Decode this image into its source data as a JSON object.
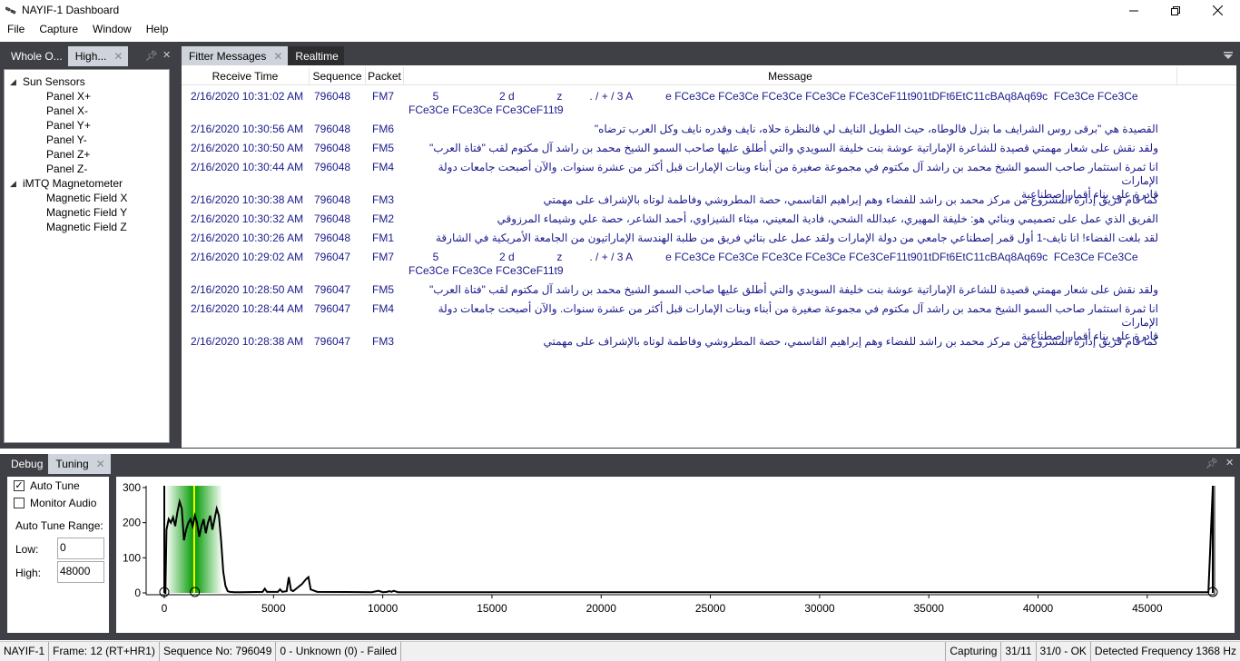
{
  "window": {
    "title": "NAYIF-1 Dashboard"
  },
  "menu": [
    "File",
    "Capture",
    "Window",
    "Help"
  ],
  "left_tabs": [
    {
      "label": "Whole O..."
    },
    {
      "label": "High..."
    }
  ],
  "main_tabs": [
    {
      "label": "Fitter Messages"
    },
    {
      "label": "Realtime"
    }
  ],
  "tree": {
    "groups": [
      {
        "label": "Sun Sensors",
        "children": [
          "Panel X+",
          "Panel X-",
          "Panel Y+",
          "Panel Y-",
          "Panel Z+",
          "Panel Z-"
        ]
      },
      {
        "label": "iMTQ Magnetometer",
        "children": [
          "Magnetic Field X",
          "Magnetic Field Y",
          "Magnetic Field Z"
        ]
      }
    ]
  },
  "grid": {
    "columns": [
      "Receive Time",
      "Sequence",
      "Packet",
      "Message"
    ],
    "rows": [
      {
        "time": "2/16/2020 10:31:02 AM",
        "seq": "796048",
        "packet": "FM7",
        "message": "        5                    2 d              z         . / + / 3 A           e FCe3Ce FCe3Ce FCe3Ce FCe3Ce FCe3CeF11t901tDFt6EtC11cBAq8Aq69c  FCe3Ce FCe3Ce\nFCe3Ce FCe3Ce FCe3CeF11t9",
        "ltr": true
      },
      {
        "time": "2/16/2020 10:30:56 AM",
        "seq": "796048",
        "packet": "FM6",
        "message": "القصيدة هي \"برقى روس الشرايف ما بنزل فالوطاه، حيث الطويل النايف لي فالنظرة حلاه، نايف وقدره نايف وكل العرب ترضاه\""
      },
      {
        "time": "2/16/2020 10:30:50 AM",
        "seq": "796048",
        "packet": "FM5",
        "message": "ولقد نقش على شعار مهمتي قصيدة للشاعرة الإماراتية عوشة بنت خليفة السويدي والتي أطلق عليها صاحب السمو الشيخ محمد بن راشد آل مكتوم لقب \"فتاة العرب\""
      },
      {
        "time": "2/16/2020 10:30:44 AM",
        "seq": "796048",
        "packet": "FM4",
        "message": "انا ثمرة استثمار صاحب السمو الشيخ محمد بن راشد آل مكتوم في مجموعة صغيرة من أبناء وبنات الإمارات قبل أكثر من عشرة سنوات. والآن أصبحت جامعات دولة الإمارات\nقادرة على بناء أقمار إصطناعية"
      },
      {
        "time": "2/16/2020 10:30:38 AM",
        "seq": "796048",
        "packet": "FM3",
        "message": "كما قام فريق إدارة المشروع من مركز محمد بن راشد للفضاء وهم إبراهيم القاسمي، حصة المطروشي وفاطمة لوتاه بالإشراف على مهمتي"
      },
      {
        "time": "2/16/2020 10:30:32 AM",
        "seq": "796048",
        "packet": "FM2",
        "message": "الفريق الذي عمل على تصميمي وبنائي هو: خليفة المهيري، عبدالله الشحي، فادية المعيني، ميثاء الشيزاوي، أحمد الشاعر، حصة علي وشيماء المرزوقي"
      },
      {
        "time": "2/16/2020 10:30:26 AM",
        "seq": "796048",
        "packet": "FM1",
        "message": "لقد بلغت الفضاء! انا نايف-1 أول قمر إصطناعي جامعي من دولة الإمارات ولقد عمل على بنائي فريق من طلبة الهندسة الإماراتيون من الجامعة الأمريكية في الشارقة"
      },
      {
        "time": "2/16/2020 10:29:02 AM",
        "seq": "796047",
        "packet": "FM7",
        "message": "        5                    2 d              z         . / + / 3 A           e FCe3Ce FCe3Ce FCe3Ce FCe3Ce FCe3CeF11t901tDFt6EtC11cBAq8Aq69c  FCe3Ce FCe3Ce\nFCe3Ce FCe3Ce FCe3CeF11t9",
        "ltr": true
      },
      {
        "time": "2/16/2020 10:28:50 AM",
        "seq": "796047",
        "packet": "FM5",
        "message": "ولقد نقش على شعار مهمتي قصيدة للشاعرة الإماراتية عوشة بنت خليفة السويدي والتي أطلق عليها صاحب السمو الشيخ محمد بن راشد آل مكتوم لقب \"فتاة العرب\""
      },
      {
        "time": "2/16/2020 10:28:44 AM",
        "seq": "796047",
        "packet": "FM4",
        "message": "انا ثمرة استثمار صاحب السمو الشيخ محمد بن راشد آل مكتوم في مجموعة صغيرة من أبناء وبنات الإمارات قبل أكثر من عشرة سنوات. والآن أصبحت جامعات دولة الإمارات\nقادرة على بناء أقمار إصطناعية"
      },
      {
        "time": "2/16/2020 10:28:38 AM",
        "seq": "796047",
        "packet": "FM3",
        "message": "كما قام فريق إدارة المشروع من مركز محمد بن راشد للفضاء وهم إبراهيم القاسمي، حصة المطروشي وفاطمة لوتاه بالإشراف على مهمتي"
      }
    ]
  },
  "bottom_tabs": [
    {
      "label": "Debug"
    },
    {
      "label": "Tuning"
    }
  ],
  "tuning": {
    "auto_tune_label": "Auto Tune",
    "auto_tune_checked": true,
    "monitor_audio_label": "Monitor Audio",
    "monitor_audio_checked": false,
    "range_label": "Auto Tune Range:",
    "low_label": "Low:",
    "low_value": "0",
    "high_label": "High:",
    "high_value": "48000"
  },
  "chart_data": {
    "type": "line",
    "x_ticks": [
      0,
      5000,
      10000,
      15000,
      20000,
      25000,
      30000,
      35000,
      40000,
      45000
    ],
    "y_ticks": [
      0,
      100,
      200,
      300
    ],
    "xlim": [
      0,
      48000
    ],
    "ylim": [
      0,
      300
    ],
    "markers": [
      0,
      1400,
      48000
    ],
    "tuned_frequency": 1368,
    "series": [
      {
        "x": [
          0,
          50,
          100,
          200,
          300,
          400,
          500,
          600,
          700,
          800,
          900,
          1000,
          1100,
          1200,
          1300,
          1400,
          1500,
          1600,
          1700,
          1800,
          1900,
          2000,
          2100,
          2200,
          2300,
          2400,
          2500,
          2600,
          2700,
          2800,
          2900,
          3000,
          3200,
          3500,
          4500,
          4600,
          4700,
          5200,
          5300,
          5400,
          5600,
          5700,
          5800,
          5900,
          6000,
          6300,
          6500,
          6600,
          6700,
          7000,
          9500,
          9800,
          10000,
          10200,
          10300,
          10400,
          10500,
          10700,
          15000,
          25000,
          35000,
          47800,
          48000
        ],
        "values": [
          0,
          0,
          180,
          210,
          200,
          215,
          190,
          230,
          260,
          240,
          150,
          180,
          200,
          210,
          190,
          220,
          200,
          160,
          190,
          210,
          170,
          200,
          220,
          180,
          210,
          240,
          220,
          150,
          60,
          20,
          5,
          3,
          2,
          2,
          3,
          12,
          3,
          3,
          10,
          3,
          5,
          45,
          8,
          5,
          10,
          25,
          40,
          45,
          10,
          3,
          2,
          6,
          2,
          3,
          5,
          3,
          6,
          2,
          2,
          2,
          2,
          2,
          300
        ]
      }
    ]
  },
  "status": {
    "sat": "NAYIF-1",
    "frame": "Frame:  12 (RT+HR1)",
    "sequence": "Sequence No:  796049",
    "decode": "0 - Unknown (0) - Failed",
    "capturing": "Capturing",
    "c1": "31/11",
    "c2": "31/0 - OK",
    "freq": "Detected Frequency  1368 Hz"
  }
}
